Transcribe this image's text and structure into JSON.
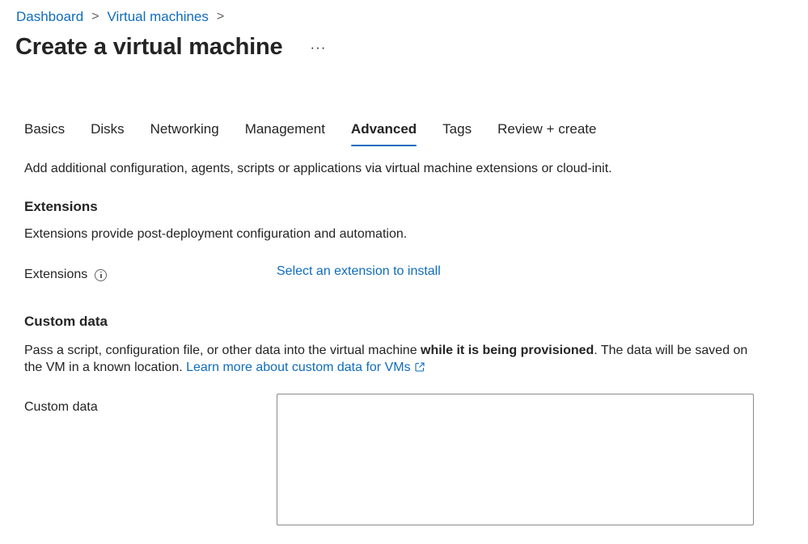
{
  "breadcrumb": {
    "items": [
      "Dashboard",
      "Virtual machines"
    ],
    "separator": ">"
  },
  "header": {
    "title": "Create a virtual machine",
    "more_label": "···"
  },
  "tabs": [
    {
      "label": "Basics",
      "active": false
    },
    {
      "label": "Disks",
      "active": false
    },
    {
      "label": "Networking",
      "active": false
    },
    {
      "label": "Management",
      "active": false
    },
    {
      "label": "Advanced",
      "active": true
    },
    {
      "label": "Tags",
      "active": false
    },
    {
      "label": "Review + create",
      "active": false
    }
  ],
  "main": {
    "intro": "Add additional configuration, agents, scripts or applications via virtual machine extensions or cloud-init.",
    "extensions": {
      "title": "Extensions",
      "description": "Extensions provide post-deployment configuration and automation.",
      "field_label": "Extensions",
      "link_label": "Select an extension to install"
    },
    "custom_data": {
      "title": "Custom data",
      "description_part1": "Pass a script, configuration file, or other data into the virtual machine ",
      "description_bold": "while it is being provisioned",
      "description_part2": ". The data will be saved on the VM in a known location. ",
      "learn_more_label": "Learn more about custom data for VMs",
      "field_label": "Custom data",
      "value": ""
    }
  },
  "colors": {
    "link": "#0f6cbd",
    "text": "#242424",
    "active_tab_underline": "#0f6cbd"
  }
}
